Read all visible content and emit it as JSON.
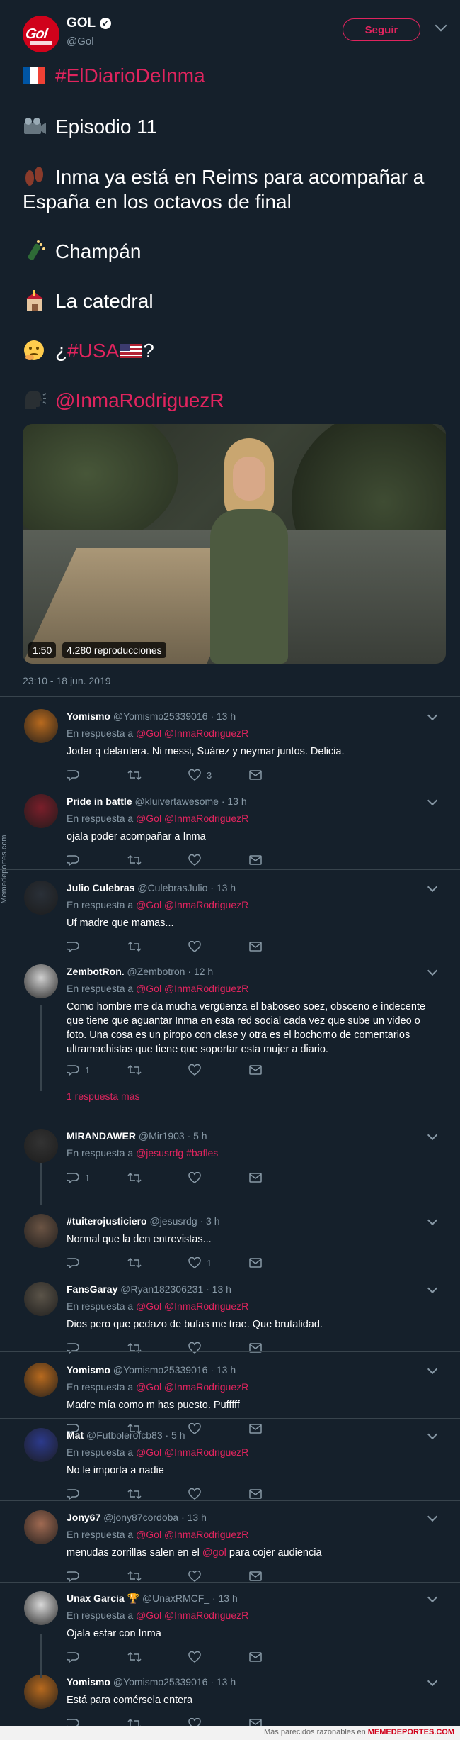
{
  "header": {
    "name": "GOL",
    "handle": "@Gol",
    "logo_text": "Gol",
    "follow_label": "Seguir"
  },
  "tweet": {
    "hashtag": "#ElDiarioDeInma",
    "episode": "Episodio 11",
    "text_line1": "Inma ya está en Reims para acompañar a",
    "text_line2": "España en los octavos de final",
    "item1": "Champán",
    "item2": "La catedral",
    "q_prefix": "¿",
    "q_hashtag": "#USA",
    "q_suffix": "?",
    "mention": "@InmaRodriguezR",
    "video_duration": "1:50",
    "video_views": "4.280 reproducciones",
    "timestamp": "23:10 - 18 jun. 2019"
  },
  "labels": {
    "in_reply_to": "En respuesta a",
    "more_replies": "1 respuesta más"
  },
  "replies": [
    {
      "name": "Yomismo",
      "handle": "@Yomismo25339016 · 13 h",
      "to": "@Gol @InmaRodriguezR",
      "text": "Joder q delantera. Ni messi, Suárez y neymar juntos. Delicia.",
      "replies": "",
      "likes": "3"
    },
    {
      "name": "Pride in battle",
      "handle": "@kluivertawesome · 13 h",
      "to": "@Gol @InmaRodriguezR",
      "text": "ojala poder acompañar a Inma",
      "replies": "",
      "likes": ""
    },
    {
      "name": "Julio Culebras",
      "handle": "@CulebrasJulio · 13 h",
      "to": "@Gol @InmaRodriguezR",
      "text": "Uf madre que mamas...",
      "replies": "",
      "likes": ""
    },
    {
      "name": "ZembotRon.",
      "handle": "@Zembotron · 12 h",
      "to": "@Gol @InmaRodriguezR",
      "text": "Como hombre me da mucha vergüenza el baboseo soez, obsceno e indecente que tiene que aguantar Inma en esta red social cada vez que sube un video o foto. Una cosa es un piropo con clase y otra es el bochorno de comentarios ultramachistas que tiene que soportar esta mujer a diario.",
      "replies": "1",
      "likes": ""
    },
    {
      "name": "MIRANDAWER",
      "handle": "@Mir1903 · 5 h",
      "to": "@jesusrdg #bafles",
      "text": "",
      "replies": "1",
      "likes": ""
    },
    {
      "name": "#tuiterojusticiero",
      "handle": "@jesusrdg · 3 h",
      "to": "",
      "text": "Normal que la den entrevistas...",
      "replies": "",
      "likes": "1"
    },
    {
      "name": "FansGaray",
      "handle": "@Ryan182306231 · 13 h",
      "to": "@Gol @InmaRodriguezR",
      "text": "Dios pero que pedazo de bufas me trae. Que brutalidad.",
      "replies": "",
      "likes": ""
    },
    {
      "name": "Yomismo",
      "handle": "@Yomismo25339016 · 13 h",
      "to": "@Gol @InmaRodriguezR",
      "text": "Madre mía como m has puesto. Pufffff",
      "replies": "",
      "likes": ""
    },
    {
      "name": "Mat",
      "handle": "@Futbolerofcb83 · 5 h",
      "to": "@Gol @InmaRodriguezR",
      "text": "No le importa a nadie",
      "replies": "",
      "likes": ""
    },
    {
      "name": "Jony67",
      "handle": "@jony87cordoba · 13 h",
      "to": "@Gol @InmaRodriguezR",
      "text_pre": "menudas zorrillas salen en el ",
      "text_link": "@gol",
      "text_post": " para cojer audiencia",
      "replies": "",
      "likes": ""
    },
    {
      "name": "Unax Garcia",
      "handle": "@UnaxRMCF_ · 13 h",
      "to": "@Gol @InmaRodriguezR",
      "text": "Ojala estar con Inma",
      "replies": "",
      "likes": ""
    },
    {
      "name": "Yomismo",
      "handle": "@Yomismo25339016 · 13 h",
      "to": "",
      "text": "Está para comérsela entera",
      "replies": "",
      "likes": ""
    }
  ],
  "watermark_side": "Memedeportes.com",
  "footer": {
    "text": "Más parecidos razonables en ",
    "brand": "MEMEDEPORTES.COM"
  },
  "colors": {
    "background": "#15202b",
    "accent": "#e0245e",
    "muted": "#8899a6",
    "divider": "#38444d"
  },
  "icons": [
    "verified-icon",
    "chevron-down-icon",
    "flag-france-icon",
    "camera-icon",
    "footprints-icon",
    "champagne-icon",
    "church-icon",
    "thinking-face-icon",
    "flag-usa-icon",
    "speaking-head-icon",
    "reply-icon",
    "retweet-icon",
    "like-icon",
    "direct-message-icon",
    "trophy-icon"
  ]
}
